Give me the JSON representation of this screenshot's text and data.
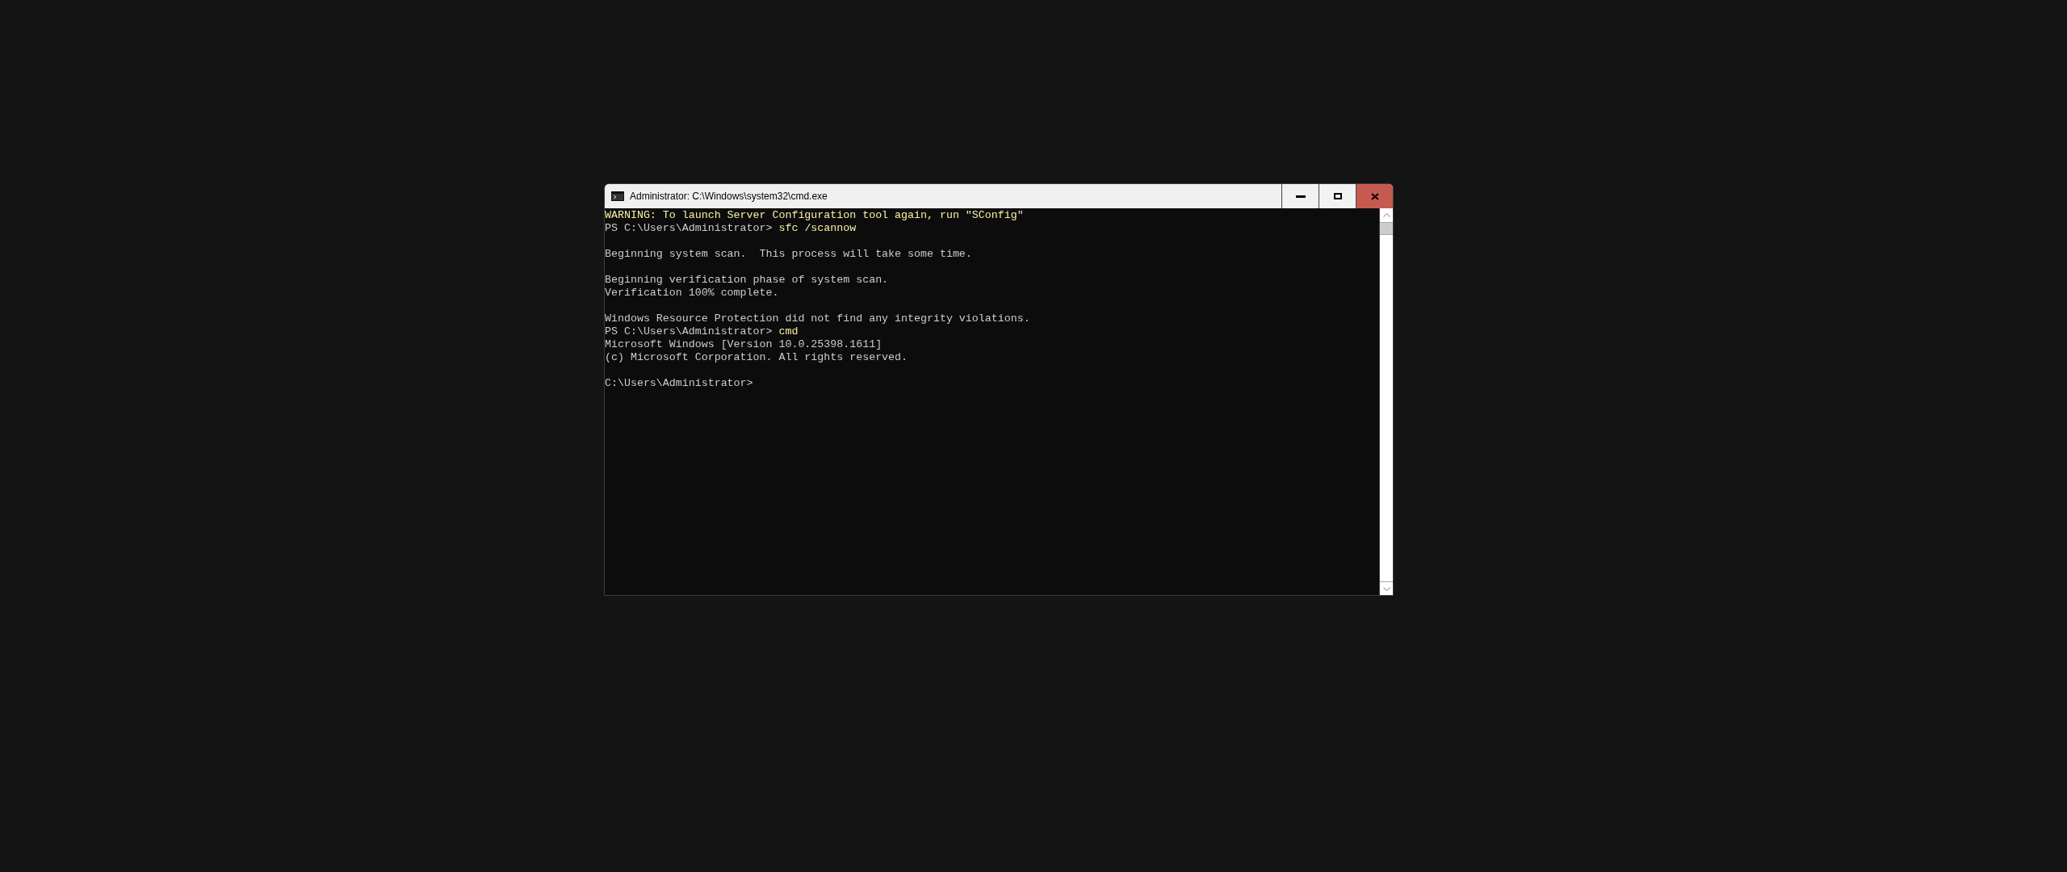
{
  "window": {
    "title": "Administrator: C:\\Windows\\system32\\cmd.exe"
  },
  "console": {
    "lines": [
      {
        "kind": "warning",
        "text": "WARNING: To launch Server Configuration tool again, run \"SConfig\""
      },
      {
        "kind": "prompt",
        "prompt": "PS C:\\Users\\Administrator>",
        "command": "sfc /scannow"
      },
      {
        "kind": "blank"
      },
      {
        "kind": "output",
        "text": "Beginning system scan.  This process will take some time."
      },
      {
        "kind": "blank"
      },
      {
        "kind": "output",
        "text": "Beginning verification phase of system scan."
      },
      {
        "kind": "output",
        "text": "Verification 100% complete."
      },
      {
        "kind": "blank"
      },
      {
        "kind": "output",
        "text": "Windows Resource Protection did not find any integrity violations."
      },
      {
        "kind": "prompt",
        "prompt": "PS C:\\Users\\Administrator>",
        "command": "cmd"
      },
      {
        "kind": "output",
        "text": "Microsoft Windows [Version 10.0.25398.1611]"
      },
      {
        "kind": "output",
        "text": "(c) Microsoft Corporation. All rights reserved."
      },
      {
        "kind": "blank"
      },
      {
        "kind": "prompt",
        "prompt": "C:\\Users\\Administrator>"
      }
    ]
  }
}
